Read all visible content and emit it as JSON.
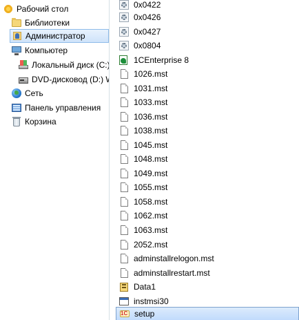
{
  "nav": {
    "items": [
      {
        "label": "Рабочий стол",
        "icon": "desktop-star-icon"
      },
      {
        "label": "Библиотеки",
        "icon": "libraries-folder-icon"
      },
      {
        "label": "Администратор",
        "icon": "user-folder-icon",
        "selected": true
      },
      {
        "label": "Компьютер",
        "icon": "computer-icon"
      },
      {
        "label": "Локальный диск (C:)",
        "icon": "local-disk-icon"
      },
      {
        "label": "DVD-дисковод (D:) W",
        "icon": "dvd-drive-icon"
      },
      {
        "label": "Сеть",
        "icon": "network-icon"
      },
      {
        "label": "Панель управления",
        "icon": "control-panel-icon"
      },
      {
        "label": "Корзина",
        "icon": "recycle-bin-icon"
      }
    ]
  },
  "files": [
    {
      "name": "0x0422",
      "icon": "config-settings-icon"
    },
    {
      "name": "0x0426",
      "icon": "config-settings-icon"
    },
    {
      "name": "0x0427",
      "icon": "config-settings-icon"
    },
    {
      "name": "0x0804",
      "icon": "config-settings-icon"
    },
    {
      "name": "1CEnterprise 8",
      "icon": "1c-installer-icon"
    },
    {
      "name": "1026.mst",
      "icon": "document-icon"
    },
    {
      "name": "1031.mst",
      "icon": "document-icon"
    },
    {
      "name": "1033.mst",
      "icon": "document-icon"
    },
    {
      "name": "1036.mst",
      "icon": "document-icon"
    },
    {
      "name": "1038.mst",
      "icon": "document-icon"
    },
    {
      "name": "1045.mst",
      "icon": "document-icon"
    },
    {
      "name": "1048.mst",
      "icon": "document-icon"
    },
    {
      "name": "1049.mst",
      "icon": "document-icon"
    },
    {
      "name": "1055.mst",
      "icon": "document-icon"
    },
    {
      "name": "1058.mst",
      "icon": "document-icon"
    },
    {
      "name": "1062.mst",
      "icon": "document-icon"
    },
    {
      "name": "1063.mst",
      "icon": "document-icon"
    },
    {
      "name": "2052.mst",
      "icon": "document-icon"
    },
    {
      "name": "adminstallrelogon.mst",
      "icon": "document-icon"
    },
    {
      "name": "adminstallrestart.mst",
      "icon": "document-icon"
    },
    {
      "name": "Data1",
      "icon": "cabinet-archive-icon"
    },
    {
      "name": "instmsi30",
      "icon": "application-window-icon"
    },
    {
      "name": "setup",
      "icon": "1c-setup-icon",
      "highlighted": true
    }
  ]
}
